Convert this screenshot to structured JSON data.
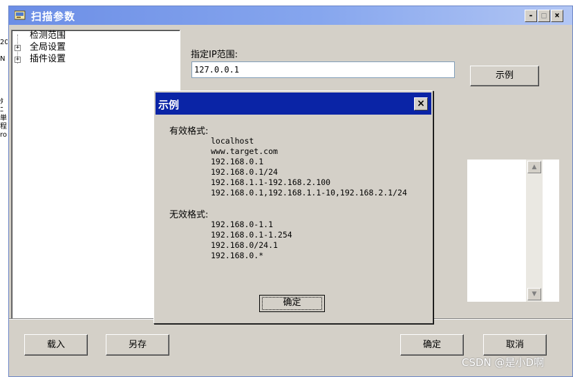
{
  "window": {
    "title": "扫描参数",
    "minimize_glyph": "-",
    "maximize_glyph": "□",
    "close_glyph": "×"
  },
  "tree": {
    "items": [
      {
        "label": "检测范围"
      },
      {
        "label": "全局设置",
        "expander": "+"
      },
      {
        "label": "插件设置",
        "expander": "+"
      }
    ]
  },
  "ip_range": {
    "label": "指定IP范围:",
    "value": "127.0.0.1",
    "example_button": "示例"
  },
  "bottom_buttons": {
    "load": "载入",
    "save_as": "另存",
    "ok": "确定",
    "cancel": "取消"
  },
  "dialog": {
    "title": "示例",
    "close_glyph": "×",
    "valid_heading": "有效格式:",
    "valid_examples": [
      "localhost",
      "www.target.com",
      "192.168.0.1",
      "192.168.0.1/24",
      "192.168.1.1-192.168.2.100",
      "192.168.0.1,192.168.1.1-10,192.168.2.1/24"
    ],
    "invalid_heading": "无效格式:",
    "invalid_examples": [
      "192.168.0-1.1",
      "192.168.0.1-1.254",
      "192.168.0/24.1",
      "192.168.0.*"
    ],
    "ok_button": "确定"
  },
  "scrollbar": {
    "up_glyph": "▲",
    "down_glyph": "▼"
  },
  "watermark": "CSDN @是小D啊",
  "background_fragments": {
    "left": [
      "20",
      "N",
      "",
      "",
      "",
      "",
      "",
      "ﾀ",
      "ﾆ",
      "単",
      "程",
      "ro"
    ],
    "right": [
      "",
      "",
      "",
      "",
      "",
      "",
      "",
      ":",
      "",
      "",
      "",
      "1"
    ]
  }
}
